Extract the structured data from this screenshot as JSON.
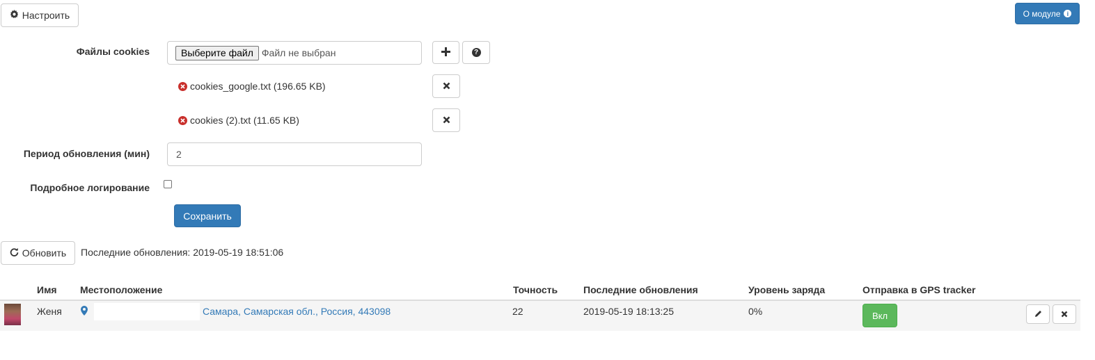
{
  "toolbar": {
    "configure_label": "Настроить",
    "about_label": "О модуле"
  },
  "form": {
    "cookies_label": "Файлы cookies",
    "file_button_label": "Выберите файл",
    "file_status": "Файл не выбран",
    "files": [
      {
        "name": "cookies_google.txt (196.65 KB)"
      },
      {
        "name": "cookies (2).txt (11.65 KB)"
      }
    ],
    "period_label": "Период обновления (мин)",
    "period_value": "2",
    "verbose_label": "Подробное логирование",
    "verbose_checked": false,
    "save_label": "Сохранить"
  },
  "refresh": {
    "button_label": "Обновить",
    "last_update_text": "Последние обновления: 2019-05-19 18:51:06"
  },
  "table": {
    "headers": {
      "name": "Имя",
      "location": "Местоположение",
      "accuracy": "Точность",
      "last_update": "Последние обновления",
      "battery": "Уровень заряда",
      "gps": "Отправка в GPS tracker"
    },
    "rows": [
      {
        "name": "Женя",
        "location": "Самара, Самарская обл., Россия, 443098",
        "accuracy": "22",
        "last_update": "2019-05-19 18:13:25",
        "battery": "0%",
        "gps_label": "Вкл"
      }
    ]
  },
  "colors": {
    "primary": "#337ab7",
    "success": "#5cb85c",
    "danger": "#c9302c",
    "row_bg": "#f5f5f5"
  }
}
